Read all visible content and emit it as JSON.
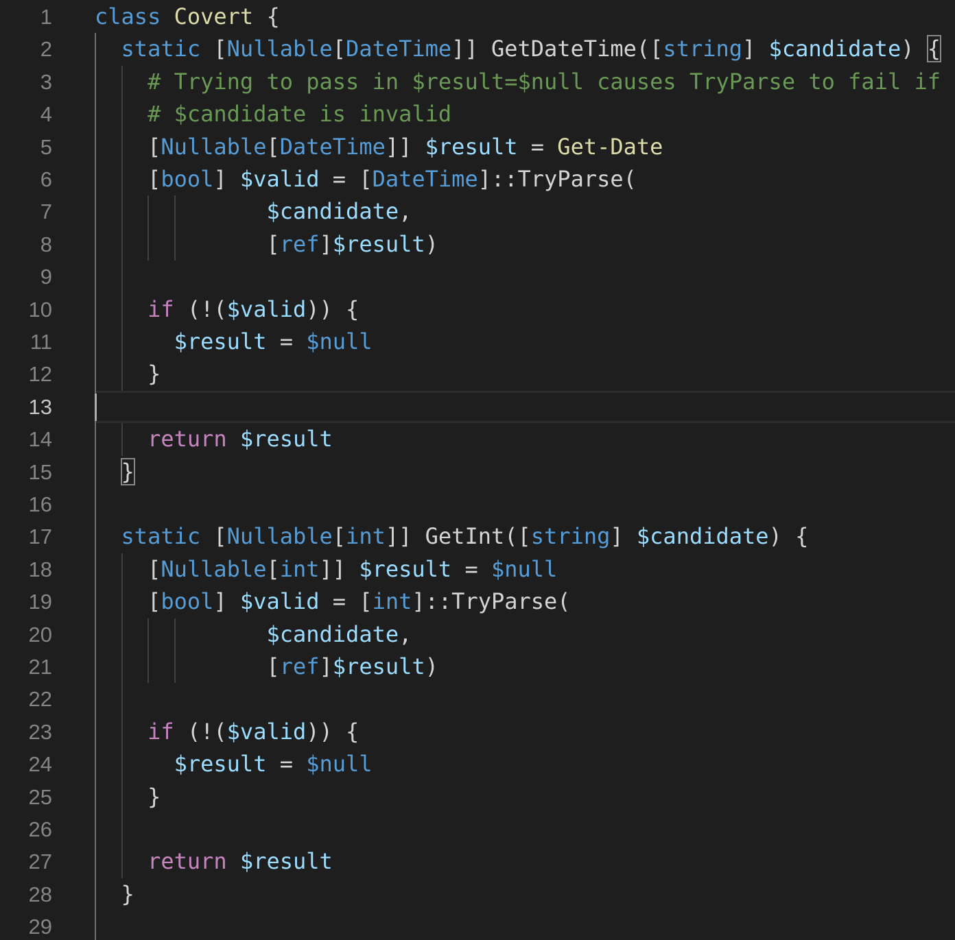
{
  "editor": {
    "language": "PowerShell",
    "cursor_line": 13,
    "lines": [
      {
        "n": "1",
        "tokens": [
          [
            "kw",
            "class"
          ],
          [
            "pun",
            " "
          ],
          [
            "fn",
            "Covert"
          ],
          [
            "pun",
            " {"
          ]
        ]
      },
      {
        "n": "2",
        "tokens": [
          [
            "pun",
            "  "
          ],
          [
            "kw",
            "static"
          ],
          [
            "pun",
            " ["
          ],
          [
            "tn",
            "Nullable"
          ],
          [
            "pun",
            "["
          ],
          [
            "tn",
            "DateTime"
          ],
          [
            "pun",
            "]] "
          ],
          [
            "pun",
            "GetDateTime"
          ],
          [
            "pun",
            "(["
          ],
          [
            "tn",
            "string"
          ],
          [
            "pun",
            "] "
          ],
          [
            "var",
            "$candidate"
          ],
          [
            "pun",
            ") "
          ],
          [
            "bm",
            "{"
          ]
        ]
      },
      {
        "n": "3",
        "tokens": [
          [
            "pun",
            "    "
          ],
          [
            "cmt",
            "# Trying to pass in $result=$null causes TryParse to fail if"
          ]
        ]
      },
      {
        "n": "4",
        "tokens": [
          [
            "pun",
            "    "
          ],
          [
            "cmt",
            "# $candidate is invalid"
          ]
        ]
      },
      {
        "n": "5",
        "tokens": [
          [
            "pun",
            "    ["
          ],
          [
            "tn",
            "Nullable"
          ],
          [
            "pun",
            "["
          ],
          [
            "tn",
            "DateTime"
          ],
          [
            "pun",
            "]] "
          ],
          [
            "var",
            "$result"
          ],
          [
            "pun",
            " = "
          ],
          [
            "fn",
            "Get-Date"
          ]
        ]
      },
      {
        "n": "6",
        "tokens": [
          [
            "pun",
            "    ["
          ],
          [
            "tn",
            "bool"
          ],
          [
            "pun",
            "] "
          ],
          [
            "var",
            "$valid"
          ],
          [
            "pun",
            " = ["
          ],
          [
            "tn",
            "DateTime"
          ],
          [
            "pun",
            "]::TryParse("
          ]
        ]
      },
      {
        "n": "7",
        "tokens": [
          [
            "pun",
            "             "
          ],
          [
            "var",
            "$candidate"
          ],
          [
            "pun",
            ","
          ]
        ]
      },
      {
        "n": "8",
        "tokens": [
          [
            "pun",
            "             ["
          ],
          [
            "tn",
            "ref"
          ],
          [
            "pun",
            "]"
          ],
          [
            "var",
            "$result"
          ],
          [
            "pun",
            ")"
          ]
        ]
      },
      {
        "n": "9",
        "tokens": []
      },
      {
        "n": "10",
        "tokens": [
          [
            "pun",
            "    "
          ],
          [
            "ctl",
            "if"
          ],
          [
            "pun",
            " (!("
          ],
          [
            "var",
            "$valid"
          ],
          [
            "pun",
            ")) {"
          ]
        ]
      },
      {
        "n": "11",
        "tokens": [
          [
            "pun",
            "      "
          ],
          [
            "var",
            "$result"
          ],
          [
            "pun",
            " = "
          ],
          [
            "kw",
            "$null"
          ]
        ]
      },
      {
        "n": "12",
        "tokens": [
          [
            "pun",
            "    }"
          ]
        ]
      },
      {
        "n": "13",
        "tokens": []
      },
      {
        "n": "14",
        "tokens": [
          [
            "pun",
            "    "
          ],
          [
            "ctl",
            "return"
          ],
          [
            "pun",
            " "
          ],
          [
            "var",
            "$result"
          ]
        ]
      },
      {
        "n": "15",
        "tokens": [
          [
            "pun",
            "  "
          ],
          [
            "bm",
            "}"
          ]
        ]
      },
      {
        "n": "16",
        "tokens": []
      },
      {
        "n": "17",
        "tokens": [
          [
            "pun",
            "  "
          ],
          [
            "kw",
            "static"
          ],
          [
            "pun",
            " ["
          ],
          [
            "tn",
            "Nullable"
          ],
          [
            "pun",
            "["
          ],
          [
            "tn",
            "int"
          ],
          [
            "pun",
            "]] "
          ],
          [
            "pun",
            "GetInt"
          ],
          [
            "pun",
            "(["
          ],
          [
            "tn",
            "string"
          ],
          [
            "pun",
            "] "
          ],
          [
            "var",
            "$candidate"
          ],
          [
            "pun",
            ") {"
          ]
        ]
      },
      {
        "n": "18",
        "tokens": [
          [
            "pun",
            "    ["
          ],
          [
            "tn",
            "Nullable"
          ],
          [
            "pun",
            "["
          ],
          [
            "tn",
            "int"
          ],
          [
            "pun",
            "]] "
          ],
          [
            "var",
            "$result"
          ],
          [
            "pun",
            " = "
          ],
          [
            "kw",
            "$null"
          ]
        ]
      },
      {
        "n": "19",
        "tokens": [
          [
            "pun",
            "    ["
          ],
          [
            "tn",
            "bool"
          ],
          [
            "pun",
            "] "
          ],
          [
            "var",
            "$valid"
          ],
          [
            "pun",
            " = ["
          ],
          [
            "tn",
            "int"
          ],
          [
            "pun",
            "]::TryParse("
          ]
        ]
      },
      {
        "n": "20",
        "tokens": [
          [
            "pun",
            "             "
          ],
          [
            "var",
            "$candidate"
          ],
          [
            "pun",
            ","
          ]
        ]
      },
      {
        "n": "21",
        "tokens": [
          [
            "pun",
            "             ["
          ],
          [
            "tn",
            "ref"
          ],
          [
            "pun",
            "]"
          ],
          [
            "var",
            "$result"
          ],
          [
            "pun",
            ")"
          ]
        ]
      },
      {
        "n": "22",
        "tokens": []
      },
      {
        "n": "23",
        "tokens": [
          [
            "pun",
            "    "
          ],
          [
            "ctl",
            "if"
          ],
          [
            "pun",
            " (!("
          ],
          [
            "var",
            "$valid"
          ],
          [
            "pun",
            ")) {"
          ]
        ]
      },
      {
        "n": "24",
        "tokens": [
          [
            "pun",
            "      "
          ],
          [
            "var",
            "$result"
          ],
          [
            "pun",
            " = "
          ],
          [
            "kw",
            "$null"
          ]
        ]
      },
      {
        "n": "25",
        "tokens": [
          [
            "pun",
            "    }"
          ]
        ]
      },
      {
        "n": "26",
        "tokens": []
      },
      {
        "n": "27",
        "tokens": [
          [
            "pun",
            "    "
          ],
          [
            "ctl",
            "return"
          ],
          [
            "pun",
            " "
          ],
          [
            "var",
            "$result"
          ]
        ]
      },
      {
        "n": "28",
        "tokens": [
          [
            "pun",
            "  }"
          ]
        ]
      },
      {
        "n": "29",
        "tokens": []
      }
    ]
  },
  "colors": {
    "background": "#1e1e1e",
    "line_number": "#858585",
    "keyword": "#569cd6",
    "control": "#c586c0",
    "function": "#dcdcaa",
    "variable": "#9cdcfe",
    "comment": "#6a9955",
    "punctuation": "#d4d4d4"
  }
}
